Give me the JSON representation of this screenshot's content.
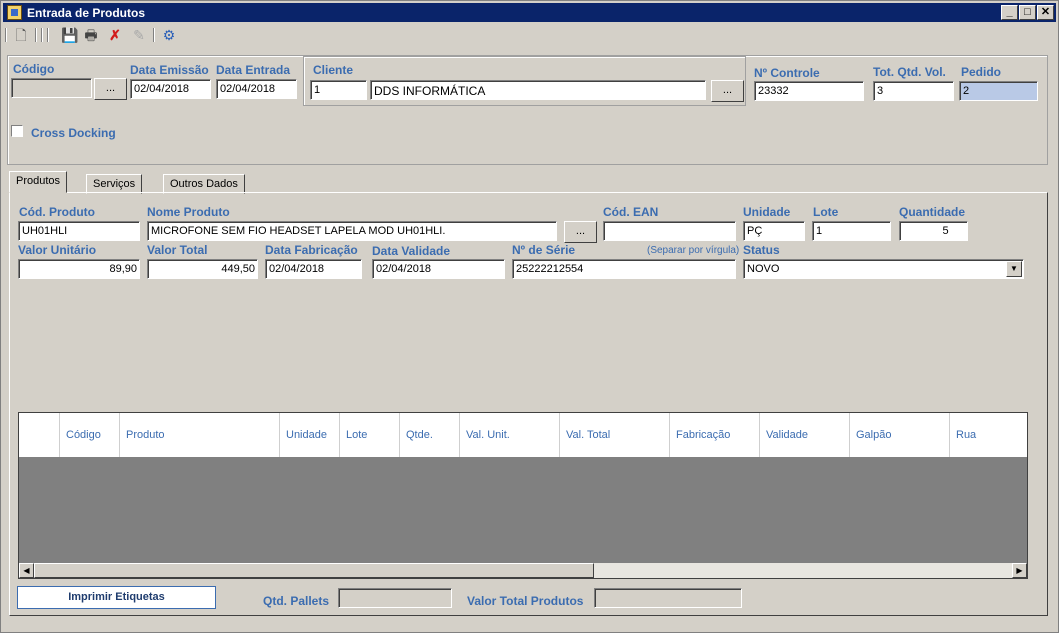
{
  "window": {
    "title": "Entrada de Produtos"
  },
  "controls": {
    "minimize": "_",
    "maximize": "□",
    "close": "✕"
  },
  "toolbar": {
    "icons": [
      "new-doc-icon",
      "save-icon",
      "print-icon",
      "delete-icon",
      "edit-icon",
      "settings-icon"
    ]
  },
  "header": {
    "codigo_label": "Código",
    "codigo_value": "",
    "lookup_label": "...",
    "data_emissao_label": "Data Emissão",
    "data_emissao_value": "02/04/2018",
    "data_entrada_label": "Data Entrada",
    "data_entrada_value": "02/04/2018",
    "cliente_label": "Cliente",
    "cliente_codigo": "1",
    "cliente_nome": "DDS INFORMÁTICA",
    "controle_label": "Nº Controle",
    "controle_value": "23332",
    "tot_qtd_label": "Tot. Qtd. Vol.",
    "tot_qtd_value": "3",
    "pedido_label": "Pedido",
    "pedido_value": "2",
    "cross_docking_label": "Cross Docking"
  },
  "tabs": [
    {
      "label": "Produtos"
    },
    {
      "label": "Serviços"
    },
    {
      "label": "Outros Dados"
    }
  ],
  "produto": {
    "cod_label": "Cód. Produto",
    "cod_value": "UH01HLI",
    "nome_label": "Nome Produto",
    "nome_value": "MICROFONE SEM FIO HEADSET LAPELA MOD UH01HLI.",
    "ean_label": "Cód. EAN",
    "ean_value": "",
    "unidade_label": "Unidade",
    "unidade_value": "PÇ",
    "lote_label": "Lote",
    "lote_value": "1",
    "quantidade_label": "Quantidade",
    "quantidade_value": "5",
    "valor_unit_label": "Valor Unitário",
    "valor_unit_value": "89,90",
    "valor_total_label": "Valor Total",
    "valor_total_value": "449,50",
    "fabricacao_label": "Data Fabricação",
    "fabricacao_value": "02/04/2018",
    "validade_label": "Data Validade",
    "validade_value": "02/04/2018",
    "serie_label": "Nº de Série",
    "serie_hint": "(Separar por vírgula)",
    "serie_value": "25222212554",
    "status_label": "Status",
    "status_value": "NOVO"
  },
  "grid": {
    "columns": [
      "Código",
      "Produto",
      "Unidade",
      "Lote",
      "Qtde.",
      "Val. Unit.",
      "Val. Total",
      "Fabricação",
      "Validade",
      "Galpão",
      "Rua"
    ]
  },
  "footer": {
    "imprimir_label": "Imprimir Etiquetas",
    "pallets_label": "Qtd. Pallets",
    "pallets_value": "",
    "valor_total_label": "Valor Total Produtos",
    "valor_total_value": ""
  }
}
